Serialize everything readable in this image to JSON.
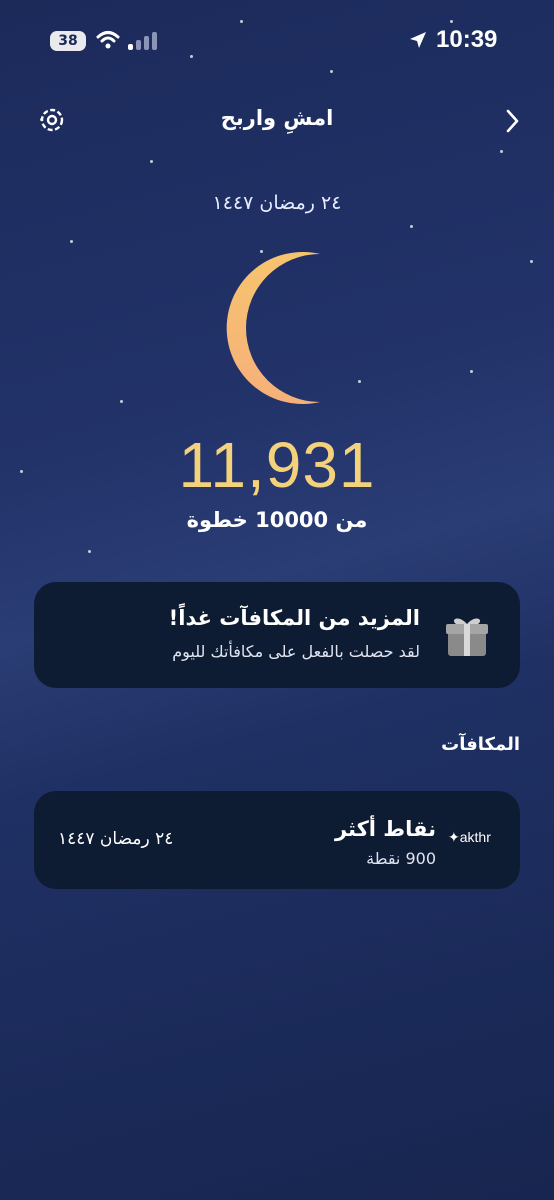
{
  "status_bar": {
    "battery": "38",
    "time": "10:39",
    "icons": [
      "battery-icon",
      "wifi-icon",
      "signal-icon",
      "location-arrow-icon"
    ]
  },
  "header": {
    "title": "امشِ واربح",
    "icons": [
      "settings-gear-icon",
      "chevron-right-icon"
    ]
  },
  "main": {
    "hijri_date": "٢٤ رمضان ١٤٤٧",
    "moon_icon": "crescent-moon-icon",
    "steps": "11,931",
    "steps_goal": "من 10000 خطوة"
  },
  "reward_card": {
    "title": "المزيد من المكافآت غداً!",
    "subtitle": "لقد حصلت بالفعل على مكافأتك لليوم",
    "icon": "gift-box-icon"
  },
  "rewards_section": {
    "title": "المكافآت",
    "items": [
      {
        "logo": "akthr",
        "title": "نقاط أكثر",
        "points": "900 نقطة",
        "date": "٢٤ رمضان ١٤٤٧"
      }
    ]
  },
  "colors": {
    "accent_steps": "#f4d27c",
    "card_bg": "#0e1c33",
    "moon": "#f7c36e"
  }
}
